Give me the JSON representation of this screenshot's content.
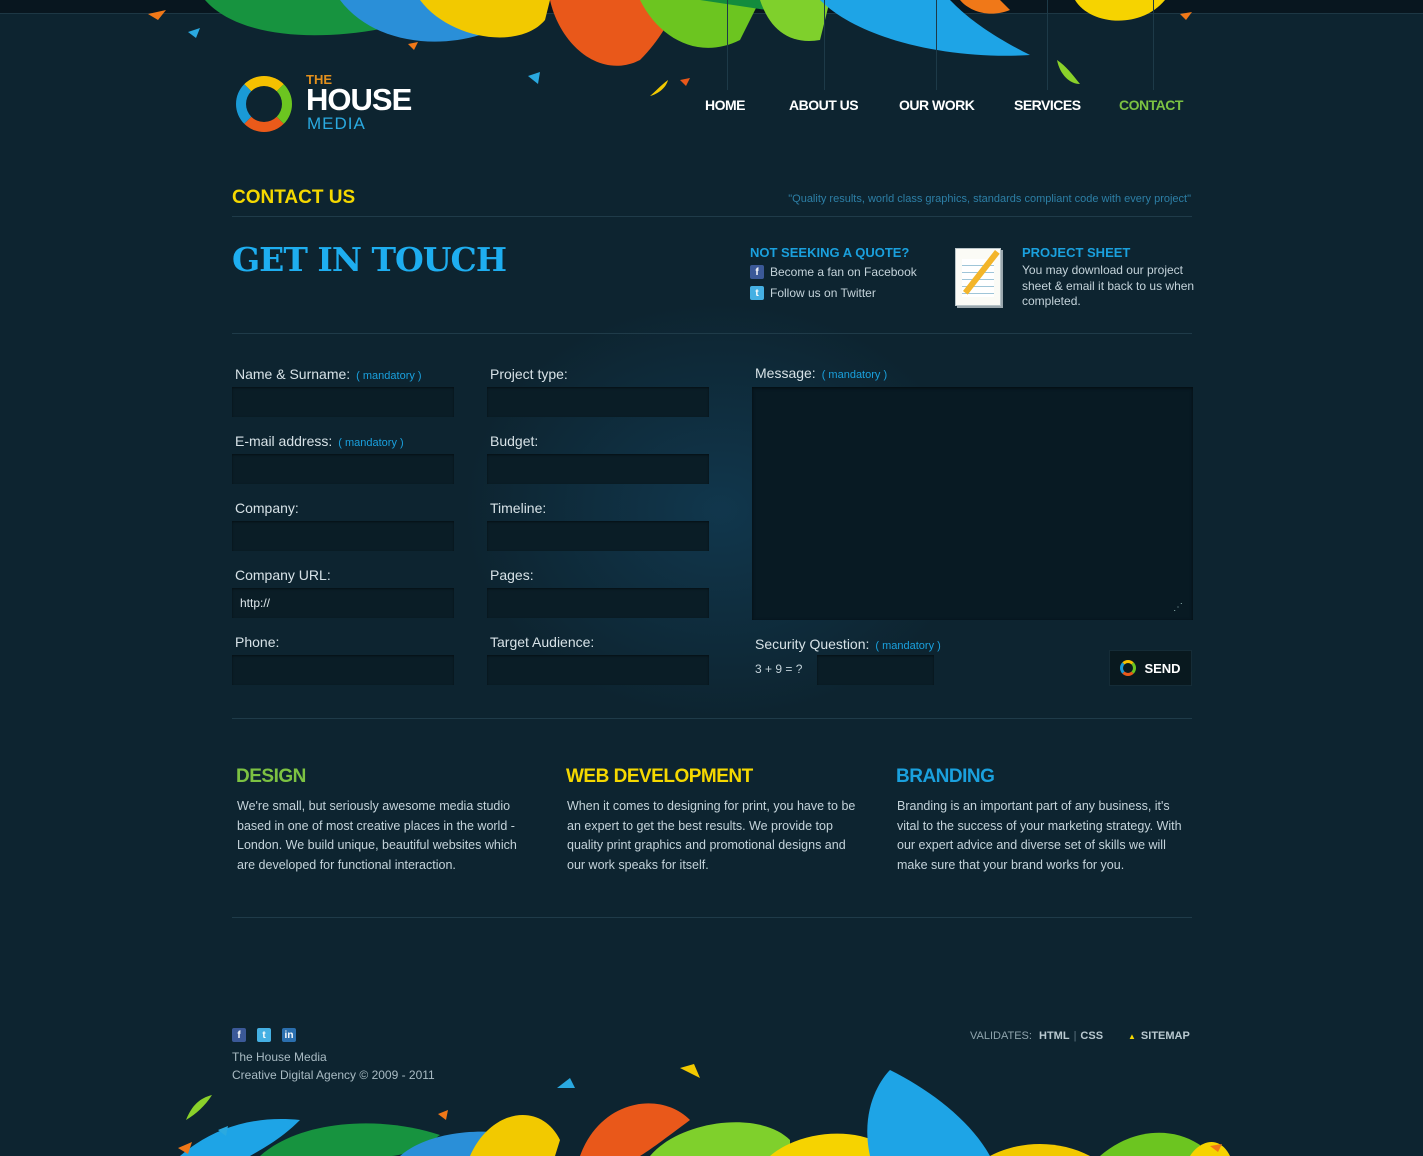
{
  "brand": {
    "the": "THE",
    "house": "HOUSE",
    "media": "MEDIA"
  },
  "nav": [
    "HOME",
    "ABOUT US",
    "OUR WORK",
    "SERVICES",
    "CONTACT"
  ],
  "contact_title": "CONTACT US",
  "quote": "\"Quality results, world class graphics, standards compliant code with every project\"",
  "heading": "GET IN TOUCH",
  "not_seeking": {
    "title": "NOT SEEKING A QUOTE?",
    "facebook": "Become a fan on Facebook",
    "twitter": "Follow us on Twitter"
  },
  "project_sheet": {
    "title": "PROJECT SHEET",
    "text": "You may download our project sheet & email it back to us when completed."
  },
  "form": {
    "mandatory": "( mandatory )",
    "name_label": "Name & Surname:",
    "email_label": "E-mail address:",
    "company_label": "Company:",
    "company_url_label": "Company URL:",
    "company_url_value": "http://",
    "phone_label": "Phone:",
    "project_type_label": "Project type:",
    "budget_label": "Budget:",
    "timeline_label": "Timeline:",
    "pages_label": "Pages:",
    "target_label": "Target Audience:",
    "message_label": "Message:",
    "security_label": "Security Question:",
    "security_question": "3 + 9 = ?",
    "send": "SEND"
  },
  "services": [
    {
      "title": "DESIGN",
      "color": "#7cc242",
      "text": "We're small, but seriously awesome media studio based in one of most creative places in the world - London. We build unique, beautiful websites which are developed for functional interaction."
    },
    {
      "title": "WEB DEVELOPMENT",
      "color": "#f5d800",
      "text": "When it comes to designing for print, you have to be an expert to get the best results. We provide top quality print graphics and promotional designs and our work speaks for itself."
    },
    {
      "title": "BRANDING",
      "color": "#1aa0dd",
      "text": "Branding is an important part of any business, it's vital to the success of your marketing strategy. With our expert advice and diverse set of skills we will make sure that your brand works for you."
    }
  ],
  "footer": {
    "company": "The House Media",
    "copyright": "Creative Digital Agency © 2009 - 2011",
    "validates": "VALIDATES:",
    "html": "HTML",
    "css": "CSS",
    "sitemap": "SITEMAP"
  },
  "colors": {
    "background": "#0d2430",
    "accent_green": "#7cc242",
    "accent_yellow": "#f5d800",
    "accent_blue": "#1aa0dd"
  }
}
